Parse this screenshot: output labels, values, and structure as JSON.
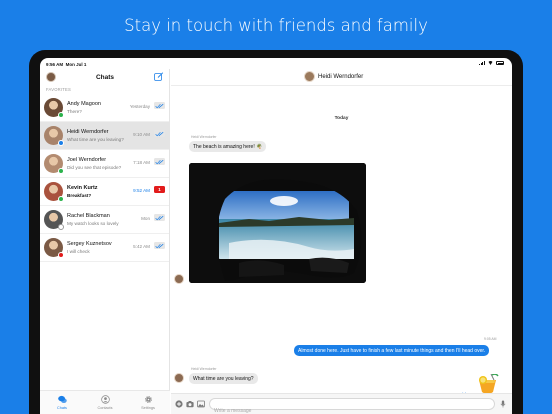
{
  "headline": "Stay in touch with friends and family",
  "status": {
    "time": "9:56 AM",
    "date": "Mon Jul 1"
  },
  "sidebar": {
    "title": "Chats",
    "favorites_label": "FAVORITES",
    "chats": [
      {
        "name": "Andy Magoon",
        "preview": "There?",
        "time": "Yesterday",
        "status": "read",
        "presence": "#2bb24c",
        "avatar": "#6a4a36",
        "selected": false,
        "unread": false
      },
      {
        "name": "Heidi Werndorfer",
        "preview": "What time are you leaving?",
        "time": "9:10 AM",
        "status": "read",
        "presence": "#1a7fe8",
        "avatar": "#a8836a",
        "selected": true,
        "unread": false
      },
      {
        "name": "Joel Werndorfer",
        "preview": "Did you see that episode?",
        "time": "7:18 AM",
        "status": "read",
        "presence": "#2bb24c",
        "avatar": "#b38b70",
        "selected": false,
        "unread": false
      },
      {
        "name": "Kevin Kurtz",
        "preview": "Breakfast?",
        "time": "9:52 AM",
        "status": "unread",
        "unread_count": "1",
        "presence": "#2bb24c",
        "avatar": "#a9523d",
        "selected": false,
        "unread": true
      },
      {
        "name": "Rachel Blackman",
        "preview": "My watch looks so lovely",
        "time": "Mon",
        "status": "read",
        "presence": "#ffffff",
        "avatar": "#555555",
        "selected": false,
        "unread": false
      },
      {
        "name": "Sergey Kuznetsov",
        "preview": "I will check",
        "time": "5:42 AM",
        "status": "read",
        "presence": "#e21b1b",
        "avatar": "#7b5a45",
        "selected": false,
        "unread": false
      }
    ]
  },
  "tabs": [
    {
      "label": "Chats",
      "icon": "chat-bubbles-icon",
      "active": true
    },
    {
      "label": "Contacts",
      "icon": "contact-icon",
      "active": false
    },
    {
      "label": "Settings",
      "icon": "gear-icon",
      "active": false
    }
  ],
  "conversation": {
    "contact_name": "Heidi Werndorfer",
    "day_separator": "Today",
    "messages": [
      {
        "direction": "in",
        "sender": "Heidi Werndorfer",
        "text": "The beach is amazing here! 🌴"
      },
      {
        "direction": "in",
        "sender": "Heidi Werndorfer",
        "type": "photo"
      },
      {
        "direction": "out",
        "time": "9:05 AM",
        "text": "Almost done here. Just have to finish a few last minute things and then I'll head over."
      },
      {
        "direction": "out",
        "type": "sticker",
        "sticker": "cocktail"
      },
      {
        "direction": "in",
        "sender": "Heidi Werndorfer",
        "text": "What time are you leaving?"
      }
    ],
    "composer_placeholder": "Write a message",
    "accent": "#1a7fe8"
  }
}
